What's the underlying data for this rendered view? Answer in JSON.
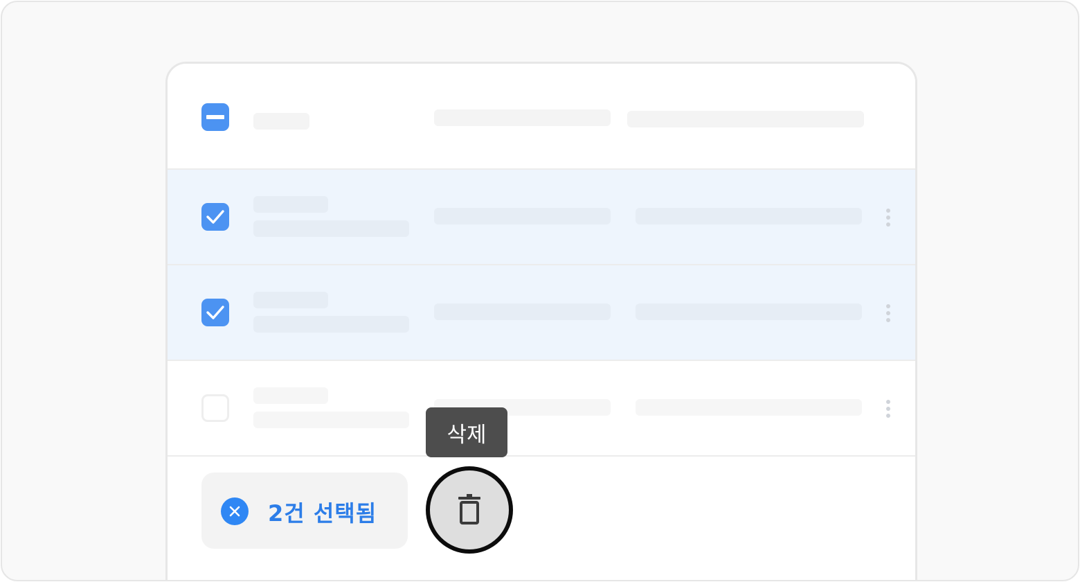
{
  "selection_bar": {
    "count_label": "2건 선택됨",
    "clear_icon": "close-circle-icon",
    "accent_color": "#2f87f4"
  },
  "toolbar": {
    "delete_tooltip": "삭제",
    "delete_icon": "trash-icon"
  },
  "table": {
    "header": {
      "checkbox_state": "indeterminate"
    },
    "rows": [
      {
        "checked": true,
        "menu_icon": "more-vertical-icon"
      },
      {
        "checked": true,
        "menu_icon": "more-vertical-icon"
      },
      {
        "checked": false,
        "menu_icon": "more-vertical-icon"
      }
    ]
  },
  "colors": {
    "checkbox_checked": "#4c93f2",
    "selected_row_bg": "#eef5fd",
    "tooltip_bg": "#4d4d4d"
  }
}
